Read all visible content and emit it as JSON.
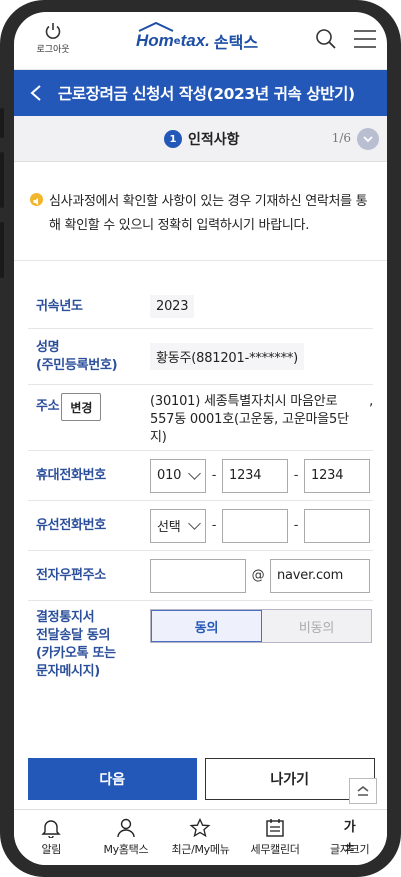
{
  "header": {
    "logout_label": "로그아웃",
    "logo_home": "Hom",
    "logo_e": "e",
    "logo_tax": "tax.",
    "logo_sontax": "손택스",
    "accent": "#1e4fa6"
  },
  "title_bar": {
    "title": "근로장려금 신청서 작성(2023년 귀속 상반기)",
    "color": "#2458b8"
  },
  "step": {
    "number": "1",
    "label": "인적사항",
    "count": "1/6"
  },
  "notice": {
    "text": "심사과정에서 확인할 사항이 있는 경우 기재하신 연락처를 통해 확인할 수 있으니 정확히 입력하시기 바랍니다."
  },
  "form": {
    "year_label": "귀속년도",
    "year_value": "2023",
    "name_label": "성명",
    "name_sub_label": "(주민등록번호)",
    "name_value": "황동주(881201-*******)",
    "address_label": "주소",
    "address_change_button": "변경",
    "address_value": "(30101) 세종특별자치시 마음안로 557동 0001호(고운동, 고운마을5단지)",
    "address_comma": ",",
    "mobile_label": "휴대전화번호",
    "mobile_prefix": "010",
    "mobile_mid": "1234",
    "mobile_last": "1234",
    "landline_label": "유선전화번호",
    "landline_prefix": "선택",
    "landline_mid": "",
    "landline_last": "",
    "email_label": "전자우편주소",
    "email_local": "",
    "email_at": "@",
    "email_domain": "naver.com",
    "notify_label_1": "결정통지서",
    "notify_label_2": "전달송달 동의",
    "notify_label_3": "(카카오톡 또는",
    "notify_label_4": "문자메시지)",
    "agree_label": "동의",
    "disagree_label": "비동의",
    "dash": "-"
  },
  "actions": {
    "next_label": "다음",
    "exit_label": "나가기"
  },
  "bottom_nav": {
    "items": [
      {
        "label": "알림",
        "icon": "bell-icon"
      },
      {
        "label": "My홈택스",
        "icon": "person-icon"
      },
      {
        "label": "최근/My메뉴",
        "icon": "star-icon"
      },
      {
        "label": "세무캘린더",
        "icon": "calendar-icon"
      },
      {
        "label": "글자크기",
        "icon": "font-size-icon",
        "glyph": "가±"
      }
    ]
  }
}
